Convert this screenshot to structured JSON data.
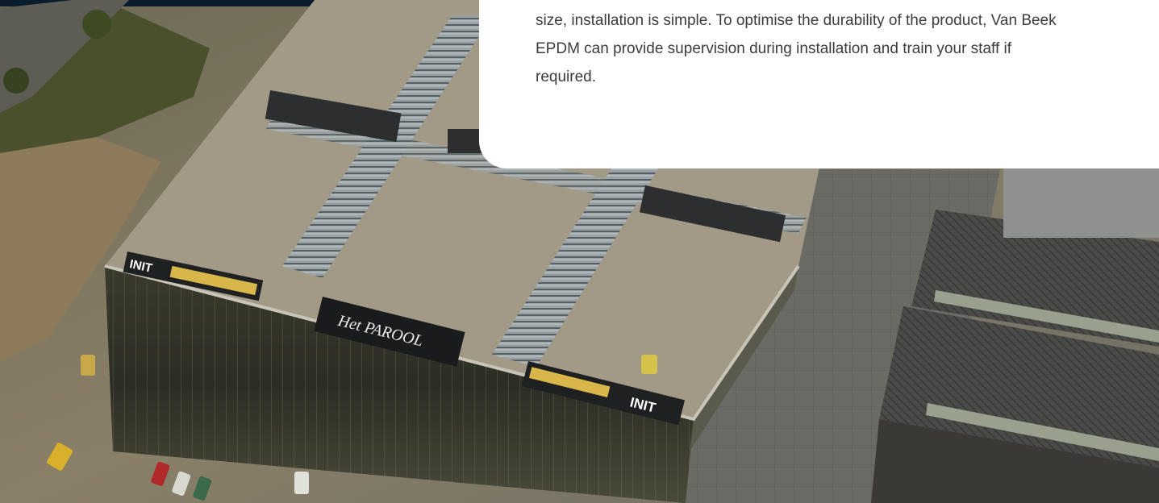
{
  "card": {
    "paragraph": "size, installation is simple. To optimise the durability of the product, Van Beek EPDM can provide supervision during installation and train your staff if required."
  },
  "photo": {
    "sign_init_left": "INIT",
    "sign_het_parool": "Het PAROOL",
    "sign_init_right": "INIT"
  },
  "colors": {
    "card_background": "#ffffff",
    "card_text": "#3c3c3c",
    "dark_banner": "#0a1b2c"
  }
}
